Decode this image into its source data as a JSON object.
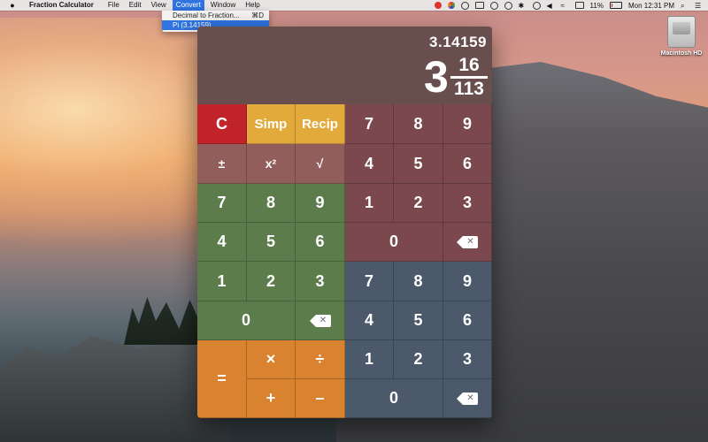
{
  "menubar": {
    "app_name": "Fraction Calculator",
    "menus": [
      "File",
      "Edit",
      "View",
      "Convert",
      "Window",
      "Help"
    ],
    "active_menu": "Convert",
    "battery": "11%",
    "clock": "Mon 12:31 PM"
  },
  "convert_menu": {
    "items": [
      {
        "label": "Decimal to Fraction...",
        "shortcut": "⌘D"
      },
      {
        "label": "Pi (3.14159)",
        "shortcut": ""
      }
    ],
    "selected_index": 1
  },
  "desktop": {
    "drive_label": "Macintosh HD"
  },
  "display": {
    "decimal": "3.14159",
    "whole": "3",
    "numerator": "16",
    "denominator": "113"
  },
  "keys": {
    "clear": "C",
    "simplify": "Simp",
    "reciprocal": "Recip",
    "plus_minus": "±",
    "square": "x²",
    "sqrt": "√",
    "equals": "=",
    "multiply": "×",
    "divide": "÷",
    "add": "+",
    "subtract": "–",
    "whole_pad": [
      "7",
      "8",
      "9",
      "4",
      "5",
      "6",
      "1",
      "2",
      "3",
      "0"
    ],
    "numerator_pad": [
      "7",
      "8",
      "9",
      "4",
      "5",
      "6",
      "1",
      "2",
      "3",
      "0"
    ],
    "denominator_pad": [
      "7",
      "8",
      "9",
      "4",
      "5",
      "6",
      "1",
      "2",
      "3",
      "0"
    ]
  },
  "colors": {
    "clear": "#c1232b",
    "function": "#e2a93b",
    "operator": "#d9822f",
    "whole_pad": "#5c804c",
    "numerator_pad": "#7d484e",
    "denominator_pad": "#4a5a6e",
    "menu_highlight": "#2f74e0"
  }
}
